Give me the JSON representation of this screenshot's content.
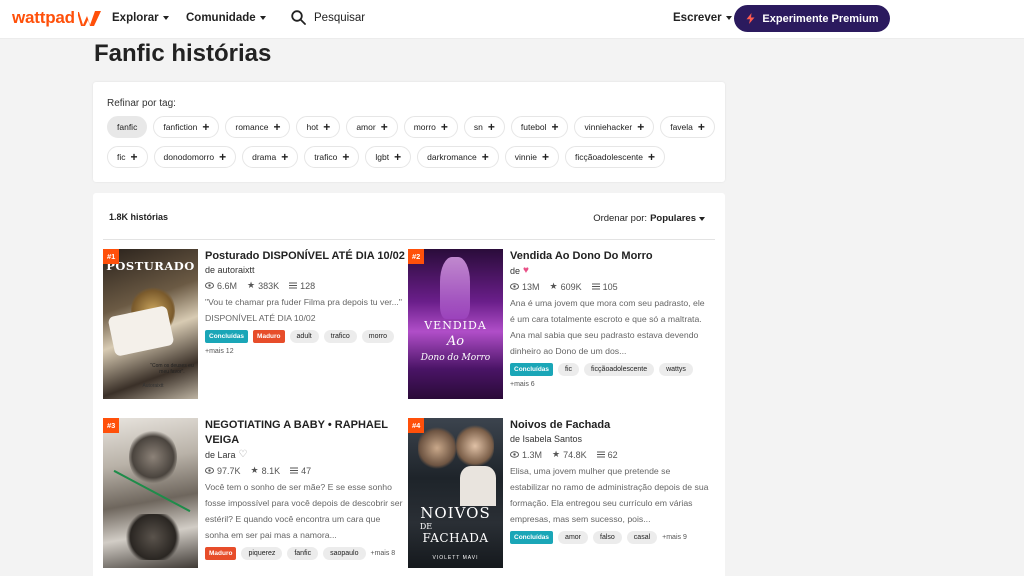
{
  "nav": {
    "logo": "wattpad",
    "explore": "Explorar",
    "community": "Comunidade",
    "search": "Pesquisar",
    "write": "Escrever",
    "premium": "Experimente Premium",
    "brand_color": "#ff500a",
    "premium_color": "#2b1a5e"
  },
  "page": {
    "title": "Fanfic histórias"
  },
  "tags": {
    "label": "Refinar por tag:",
    "row1": [
      "fanfic",
      "fanfiction",
      "romance",
      "hot",
      "amor",
      "morro",
      "sn",
      "futebol",
      "vinniehacker",
      "favela"
    ],
    "row2": [
      "fic",
      "donodomorro",
      "drama",
      "trafico",
      "lgbt",
      "darkromance",
      "vinnie",
      "ficçãoadolescente"
    ]
  },
  "results": {
    "count": "1.8K histórias",
    "sort_label": "Ordenar por:",
    "sort_value": "Populares"
  },
  "stories": [
    {
      "rank": "#1",
      "cover_text": "POSTURADO",
      "cover_caption": "\"Com os deuses eu meu favor\".",
      "cover_author": "Autoraixtt",
      "title": "Posturado DISPONÍVEL ATÉ DIA 10/02",
      "author": "de autoraixtt",
      "reads": "6.6M",
      "votes": "383K",
      "parts": "128",
      "description": "\"Vou te chamar pra fuder Filma pra depois tu ver...\" DISPONÍVEL ATÉ DIA 10/02",
      "complete": "Concluídas",
      "mature": "Maduro",
      "tags": [
        "adult",
        "trafico",
        "morro"
      ],
      "more": "+mais 12"
    },
    {
      "rank": "#2",
      "cover_text": "VENDIDA",
      "cover_sub": "Ao",
      "cover_sub2": "Dono do Morro",
      "title": "Vendida Ao Dono Do Morro",
      "author": "de",
      "reads": "13M",
      "votes": "609K",
      "parts": "105",
      "description": "Ana é uma jovem que mora com seu padrasto, ele é um cara totalmente escroto e que só a maltrata. Ana mal sabia que seu padrasto estava devendo dinheiro ao Dono de um dos...",
      "complete": "Concluídas",
      "tags": [
        "fic",
        "ficçãoadolescente",
        "wattys"
      ],
      "more": "+mais 6"
    },
    {
      "rank": "#3",
      "title": "NEGOTIATING A BABY • RAPHAEL VEIGA",
      "author": "de Lara",
      "reads": "97.7K",
      "votes": "8.1K",
      "parts": "47",
      "description": "Você tem o sonho de ser mãe? E se esse sonho fosse impossível para você depois de descobrir ser estéril? E quando você encontra um cara que sonha em ser pai mas a namora...",
      "mature": "Maduro",
      "tags": [
        "piquerez",
        "fanfic",
        "saopaulo"
      ],
      "more": "+mais 8"
    },
    {
      "rank": "#4",
      "cover_text": "NOIVOS",
      "cover_sub": "DE",
      "cover_sub2": "FACHADA",
      "cover_author": "VIOLETT MAVI",
      "title": "Noivos de Fachada",
      "author": "de Isabela Santos",
      "reads": "1.3M",
      "votes": "74.8K",
      "parts": "62",
      "description": "Elisa, uma jovem mulher que pretende se estabilizar no ramo de administração depois de sua formação. Ela entregou seu currículo em várias empresas, mas sem sucesso, pois...",
      "complete": "Concluídas",
      "tags": [
        "amor",
        "falso",
        "casal"
      ],
      "more": "+mais 9"
    }
  ]
}
